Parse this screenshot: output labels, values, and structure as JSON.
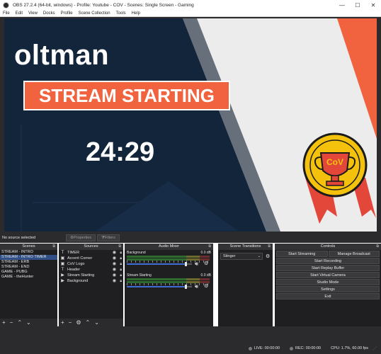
{
  "window": {
    "title": "OBS 27.2.4 (64-bit, windows) - Profile: Youtube - COV - Scenes: Single Screen - Gaming",
    "minimize": "—",
    "maximize": "☐",
    "close": "✕"
  },
  "menu": [
    "File",
    "Edit",
    "View",
    "Docks",
    "Profile",
    "Scene Collection",
    "Tools",
    "Help"
  ],
  "preview": {
    "streamer_name": "oltman",
    "banner_text": "STREAM STARTING",
    "countdown": "24:29",
    "badge_text": "CoV",
    "colors": {
      "navy": "#13253b",
      "accent": "#f0633e",
      "trophy_gold": "#f4c20d",
      "light_bg": "#ececec"
    }
  },
  "source_bar": {
    "no_source": "No source selected",
    "properties_label": "Properties",
    "filters_label": "Filters"
  },
  "scenes": {
    "title": "Scenes",
    "items": [
      {
        "label": "STREAM - INTRO",
        "selected": false
      },
      {
        "label": "STREAM - INTRO TIMER",
        "selected": true
      },
      {
        "label": "STREAM - ERB",
        "selected": false
      },
      {
        "label": "STREAM - END",
        "selected": false
      },
      {
        "label": "GAME - PUBG",
        "selected": false
      },
      {
        "label": "GAME - theHunter",
        "selected": false
      }
    ]
  },
  "sources": {
    "title": "Sources",
    "items": [
      {
        "label": "TIMER",
        "icon": "text-icon"
      },
      {
        "label": "Accent Corner",
        "icon": "image-icon"
      },
      {
        "label": "CoV Logo",
        "icon": "image-icon"
      },
      {
        "label": "Header",
        "icon": "text-icon"
      },
      {
        "label": "Stream Starting",
        "icon": "media-icon"
      },
      {
        "label": "Background",
        "icon": "media-icon"
      }
    ]
  },
  "mixer": {
    "title": "Audio Mixer",
    "tracks": [
      {
        "name": "Background",
        "db": "0.0 dB"
      },
      {
        "name": "Stream Starting",
        "db": "0.0 dB"
      }
    ]
  },
  "transitions": {
    "title": "Scene Transitions",
    "selected": "Stinger"
  },
  "controls": {
    "title": "Controls",
    "start_streaming": "Start Streaming",
    "manage_broadcast": "Manage Broadcast",
    "start_recording": "Start Recording",
    "start_replay_buffer": "Start Replay Buffer",
    "start_virtual_camera": "Start Virtual Camera",
    "studio_mode": "Studio Mode",
    "settings": "Settings",
    "exit": "Exit"
  },
  "status": {
    "live": "LIVE: 00:00:00",
    "rec": "REC: 00:00:00",
    "cpu": "CPU: 1.7%, 60.00 fps"
  }
}
